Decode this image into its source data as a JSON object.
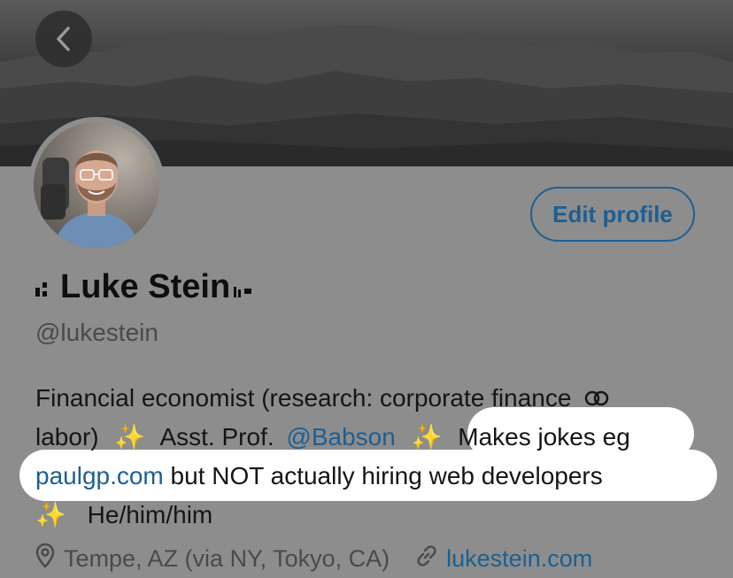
{
  "profile": {
    "display_name": "Luke Stein",
    "handle": "@lukestein",
    "edit_label": "Edit profile"
  },
  "bio": {
    "l1": "Financial economist (research: corporate finance",
    "l2a": "labor)",
    "l2b": "Asst. Prof.",
    "l2c": "@Babson",
    "l2d": "Makes jokes eg",
    "l3a": "paulgp.com",
    "l3b": "but NOT actually hiring web developers",
    "l4": "He/him/him"
  },
  "meta": {
    "location": "Tempe, AZ (via NY, Tokyo, CA)",
    "website": "lukestein.com"
  },
  "colors": {
    "link": "#1c5f93",
    "dim_background": "#8d8d8d",
    "highlight": "#ffffff"
  },
  "icons": [
    "back-arrow-icon",
    "sparkle-icon",
    "link-chain-icon",
    "location-pin-icon",
    "signal-bars-icon"
  ]
}
